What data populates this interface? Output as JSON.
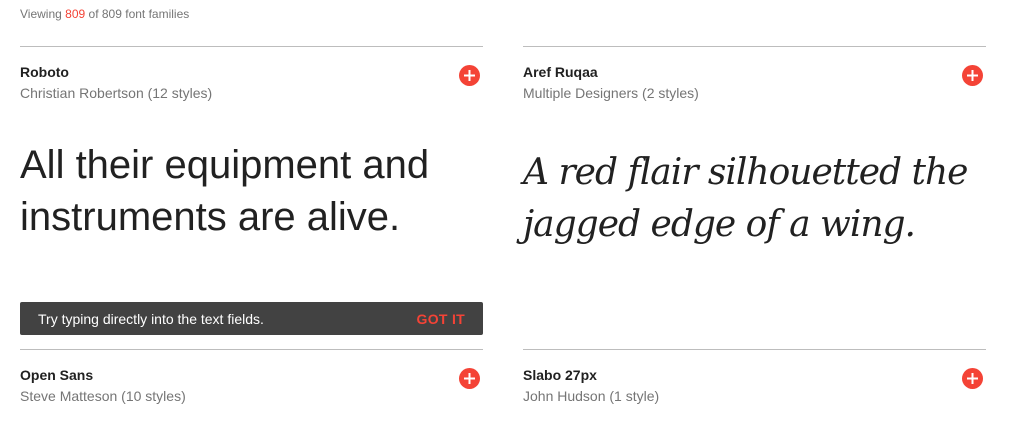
{
  "header": {
    "prefix": "Viewing",
    "shown_count": "809",
    "suffix": "of 809 font families"
  },
  "colors": {
    "accent": "#f44336",
    "toast_bg": "#424242",
    "divider": "#bdbdbd",
    "secondary_text": "#757575"
  },
  "cards": [
    {
      "name": "Roboto",
      "designer": "Christian Robertson (12 styles)",
      "sample": "All their equipment and instruments are alive.",
      "icon": "plus-icon"
    },
    {
      "name": "Aref Ruqaa",
      "designer": "Multiple Designers (2 styles)",
      "sample": "A red flair silhouetted the jagged edge of a wing.",
      "icon": "plus-icon"
    },
    {
      "name": "Open Sans",
      "designer": "Steve Matteson (10 styles)",
      "icon": "plus-icon"
    },
    {
      "name": "Slabo 27px",
      "designer": "John Hudson (1 style)",
      "icon": "plus-icon"
    }
  ],
  "toast": {
    "message": "Try typing directly into the text fields.",
    "action": "GOT IT"
  }
}
